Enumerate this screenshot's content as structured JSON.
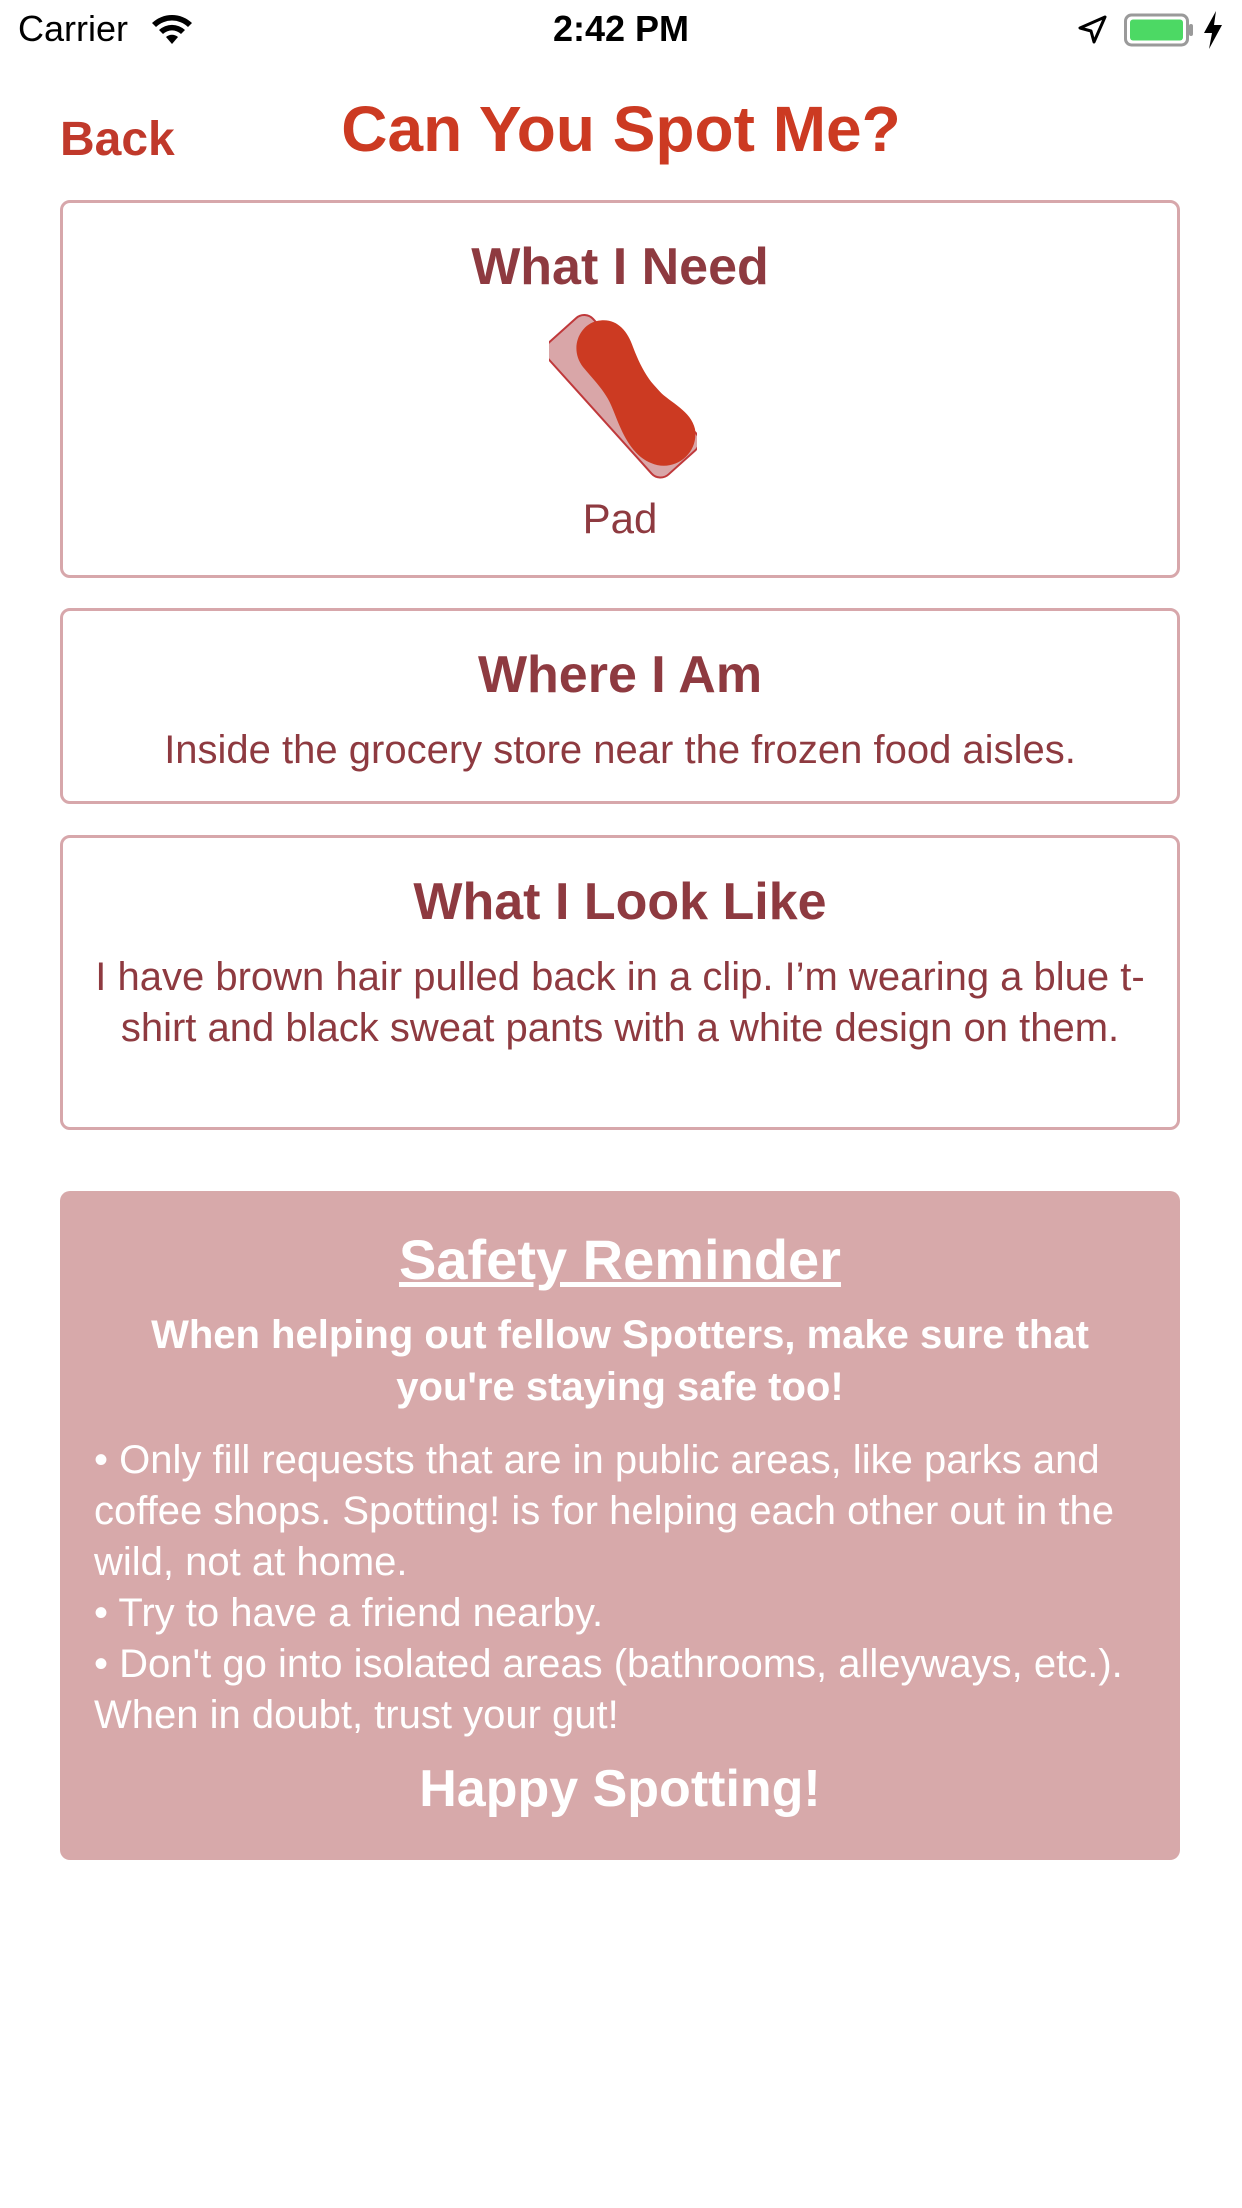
{
  "status_bar": {
    "carrier": "Carrier",
    "time": "2:42 PM",
    "battery_color": "#4cd964"
  },
  "nav": {
    "back_label": "Back",
    "title": "Can You Spot Me?"
  },
  "need_card": {
    "title": "What I Need",
    "item_label": "Pad",
    "icon": "pad-icon"
  },
  "where_card": {
    "title": "Where I Am",
    "text": "Inside the grocery store near the frozen food aisles."
  },
  "look_card": {
    "title": "What I Look Like",
    "text": "I have brown hair pulled back in a clip. I’m wearing a blue t-shirt and black sweat pants with a white design on them."
  },
  "safety": {
    "title": "Safety Reminder",
    "lead": "When helping out fellow Spotters, make sure that you're staying safe too!",
    "items": [
      "• Only fill requests that are in public areas, like parks and coffee shops. Spotting! is for helping each other out in the wild, not at home.",
      "• Try to have a friend nearby.",
      "• Don't go into isolated areas (bathrooms, alleyways, etc.). When in doubt, trust your gut!"
    ],
    "closing": "Happy Spotting!"
  },
  "colors": {
    "accent": "#cc3a22",
    "text": "#8e3a40",
    "border": "#d7a7ab",
    "safety_bg": "#d7a9aa"
  }
}
